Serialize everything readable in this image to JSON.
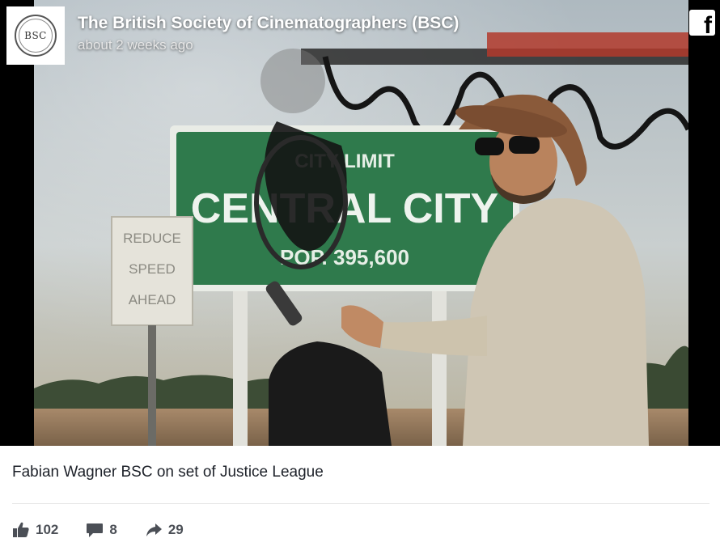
{
  "page": {
    "name": "The British Society of Cinematographers (BSC)",
    "time": "about 2 weeks ago",
    "logo_text": "BSC"
  },
  "brand": {
    "facebook_glyph": "f",
    "colors": {
      "overlay_text": "#ffffff",
      "caption_text": "#1d2129",
      "stat_text": "#4b4f56",
      "sign_green": "#2f7a4c"
    }
  },
  "photo": {
    "sign_line1": "CITY LIMIT",
    "sign_line2": "CENTRAL CITY",
    "sign_line3": "POP. 395,600",
    "small_sign_line1": "REDUCE",
    "small_sign_line2": "SPEED",
    "small_sign_line3": "AHEAD"
  },
  "post": {
    "caption": "Fabian Wagner BSC on set of Justice League"
  },
  "stats": {
    "likes": "102",
    "comments": "8",
    "shares": "29",
    "icons": [
      "like-icon",
      "comment-icon",
      "share-icon"
    ]
  }
}
